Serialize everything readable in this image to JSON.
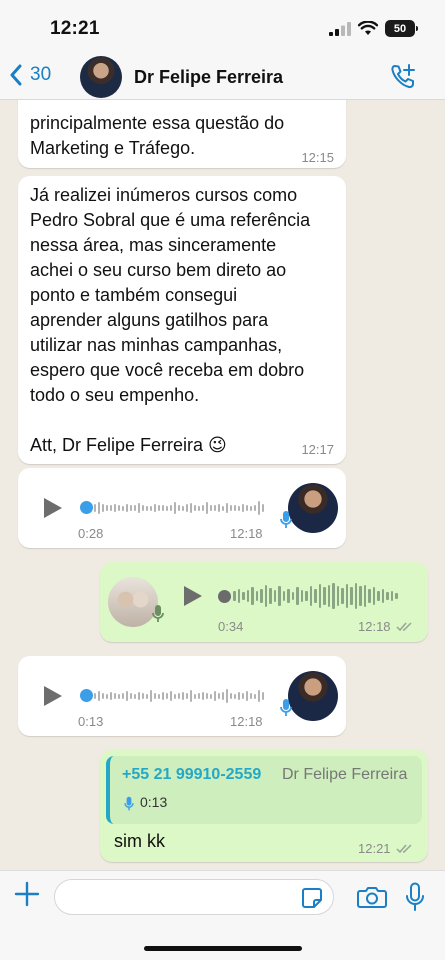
{
  "status_bar": {
    "time": "12:21",
    "battery": "50"
  },
  "header": {
    "back_count": "30",
    "contact_name": "Dr Felipe Ferreira"
  },
  "messages": {
    "m1": {
      "text": "principalmente essa questão do\nMarketing e Tráfego.",
      "time": "12:15"
    },
    "m2": {
      "text": "Já realizei inúmeros cursos como\nPedro Sobral que é uma referência\nnessa área, mas sinceramente\nachei o seu curso bem direto ao\nponto e também consegui\naprender alguns gatilhos para\nutilizar nas minhas campanhas,\nespero que você receba em dobro\ntodo o seu empenho.\n\nAtt, Dr Felipe Ferreira 😉",
      "time": "12:17"
    },
    "voice1": {
      "duration": "0:28",
      "time": "12:18"
    },
    "voice2": {
      "duration": "0:34",
      "time": "12:18"
    },
    "voice3": {
      "duration": "0:13",
      "time": "12:18"
    },
    "reply": {
      "quote_phone": "+55 21 99910-2559",
      "quote_name": "Dr Felipe Ferreira",
      "quote_duration": "0:13",
      "text": "sim kk",
      "time": "12:21"
    }
  },
  "colors": {
    "chat_bg": "#efeae2",
    "incoming_bubble": "#ffffff",
    "outgoing_bubble": "#dcf8c6",
    "accent_blue": "#1a7fc4",
    "quote_accent": "#25a8c5"
  },
  "icons": [
    "chevron-left-icon",
    "add-call-icon",
    "play-icon",
    "mic-icon",
    "plus-icon",
    "sticker-icon",
    "camera-icon",
    "double-check-icon"
  ]
}
